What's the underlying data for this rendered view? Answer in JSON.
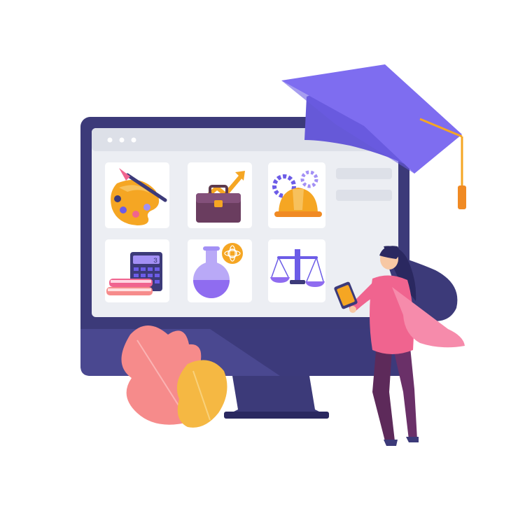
{
  "window": {
    "dots": 3,
    "sidebar_lines": 2
  },
  "course_tiles": [
    {
      "icon": "palette-icon",
      "subject": "art"
    },
    {
      "icon": "briefcase-icon",
      "subject": "business"
    },
    {
      "icon": "hard-hat-icon",
      "subject": "engineering"
    },
    {
      "icon": "calculator-icon",
      "subject": "mathematics"
    },
    {
      "icon": "flask-icon",
      "subject": "chemistry"
    },
    {
      "icon": "scales-icon",
      "subject": "law"
    }
  ],
  "calculator_display": "3",
  "colors": {
    "monitor": "#3c3a79",
    "monitor_dark": "#2a2860",
    "screen_bg": "#eceef3",
    "titlebar": "#dde0e8",
    "tile_bg": "#ffffff",
    "purple": "#6c5ce7",
    "light_purple": "#a390f5",
    "orange": "#f5a623",
    "pink": "#f0648f",
    "coral": "#f68b8b",
    "brown": "#5d3a4d"
  }
}
